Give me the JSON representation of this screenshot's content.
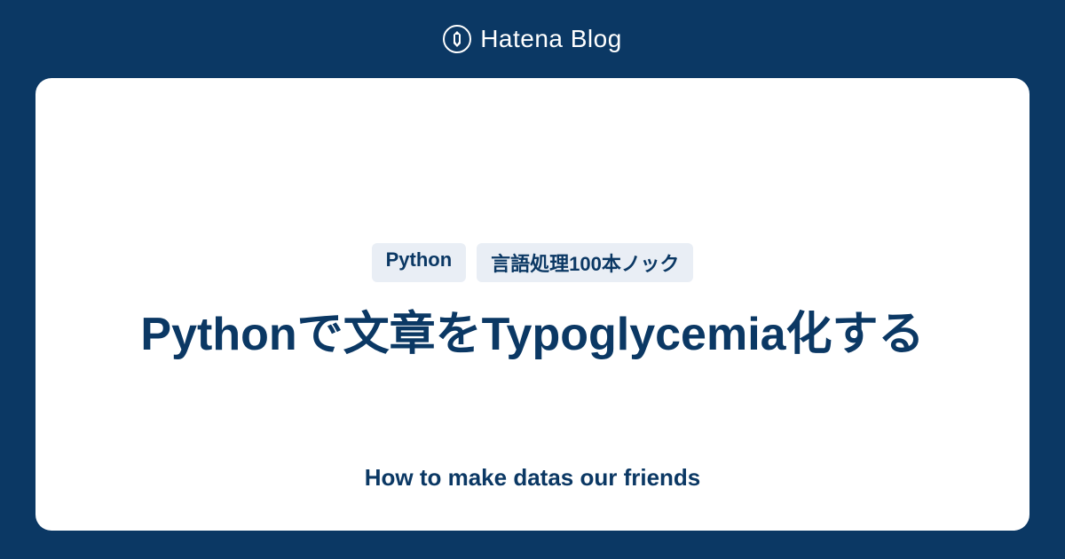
{
  "header": {
    "brand": "Hatena Blog"
  },
  "card": {
    "tags": [
      "Python",
      "言語処理100本ノック"
    ],
    "title": "Pythonで文章をTypoglycemia化する",
    "subtitle": "How to make datas our friends"
  }
}
